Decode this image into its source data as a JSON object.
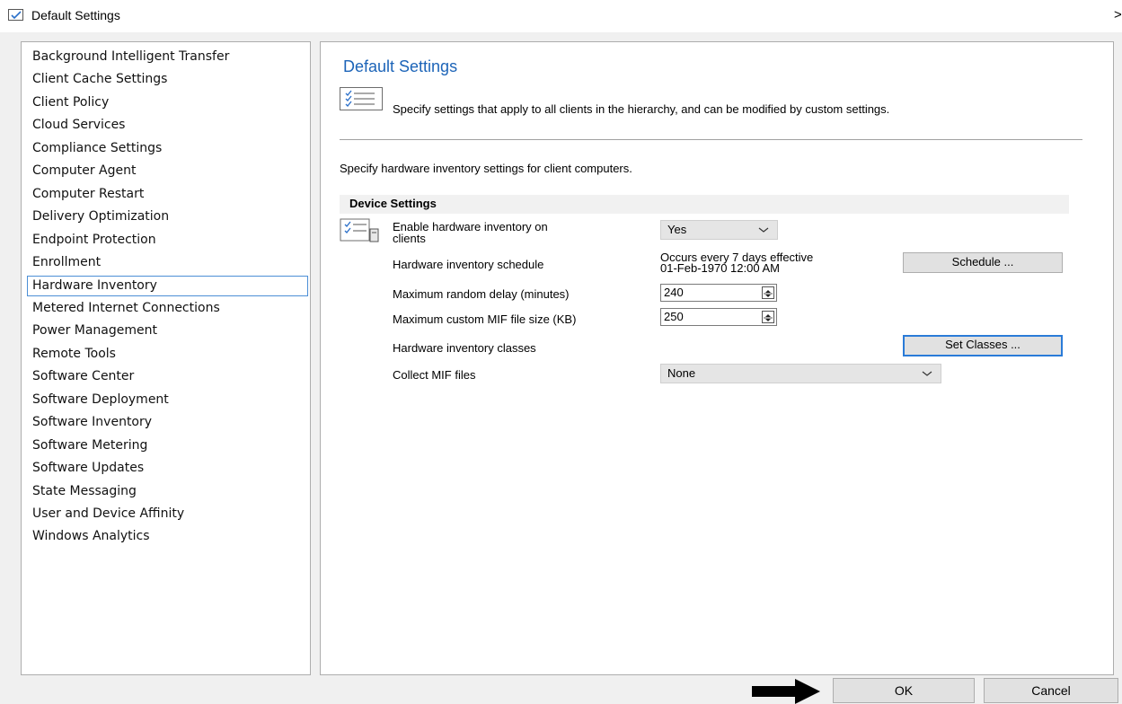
{
  "window": {
    "title": "Default Settings",
    "close_glyph": ">"
  },
  "nav": {
    "items": [
      {
        "label": "Background Intelligent Transfer",
        "selected": false
      },
      {
        "label": "Client Cache Settings",
        "selected": false
      },
      {
        "label": "Client Policy",
        "selected": false
      },
      {
        "label": "Cloud Services",
        "selected": false
      },
      {
        "label": "Compliance Settings",
        "selected": false
      },
      {
        "label": "Computer Agent",
        "selected": false
      },
      {
        "label": "Computer Restart",
        "selected": false
      },
      {
        "label": "Delivery Optimization",
        "selected": false
      },
      {
        "label": "Endpoint Protection",
        "selected": false
      },
      {
        "label": "Enrollment",
        "selected": false
      },
      {
        "label": "Hardware Inventory",
        "selected": true
      },
      {
        "label": "Metered Internet Connections",
        "selected": false
      },
      {
        "label": "Power Management",
        "selected": false
      },
      {
        "label": "Remote Tools",
        "selected": false
      },
      {
        "label": "Software Center",
        "selected": false
      },
      {
        "label": "Software Deployment",
        "selected": false
      },
      {
        "label": "Software Inventory",
        "selected": false
      },
      {
        "label": "Software Metering",
        "selected": false
      },
      {
        "label": "Software Updates",
        "selected": false
      },
      {
        "label": "State Messaging",
        "selected": false
      },
      {
        "label": "User and Device Affinity",
        "selected": false
      },
      {
        "label": "Windows Analytics",
        "selected": false
      }
    ]
  },
  "main": {
    "title": "Default Settings",
    "description": "Specify settings that apply to all clients in the hierarchy, and can be modified by custom settings.",
    "hw_description": "Specify hardware inventory settings for client computers.",
    "section": "Device Settings",
    "enable_label_line1": "Enable hardware inventory on",
    "enable_label_line2": "clients",
    "enable_value": "Yes",
    "schedule_label": "Hardware inventory schedule",
    "schedule_line1": "Occurs every 7 days effective",
    "schedule_line2": "01-Feb-1970 12:00 AM",
    "schedule_button": "Schedule ...",
    "max_delay_label": "Maximum random delay (minutes)",
    "max_delay_value": "240",
    "max_mif_label": "Maximum custom MIF file size (KB)",
    "max_mif_value": "250",
    "classes_label": "Hardware inventory classes",
    "classes_button": "Set Classes ...",
    "collect_label": "Collect MIF files",
    "collect_value": "None"
  },
  "footer": {
    "ok": "OK",
    "cancel": "Cancel"
  },
  "colors": {
    "title_blue": "#1c64b8",
    "focus_blue": "#2a7bd8",
    "selection_border": "#4c8fd6"
  }
}
